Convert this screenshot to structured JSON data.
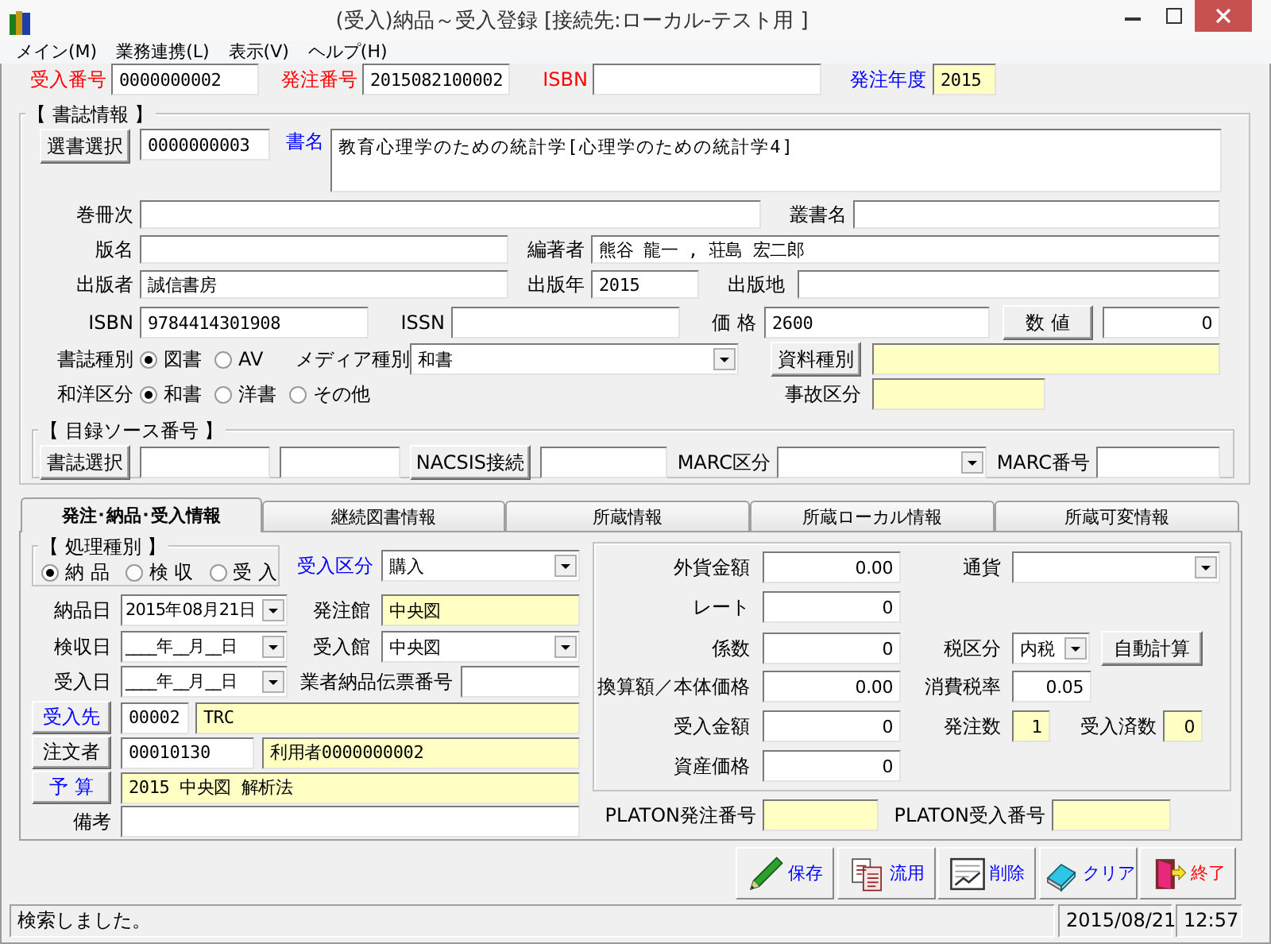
{
  "window": {
    "title": "(受入)納品～受入登録 [接続先:ローカル-テスト用 ]"
  },
  "menu": [
    {
      "label": "メイン(M)"
    },
    {
      "label": "業務連携(L)"
    },
    {
      "label": "表示(V)"
    },
    {
      "label": "ヘルプ(H)"
    }
  ],
  "header": [
    {
      "kind": "label",
      "text": "受入番号",
      "color": "#ff0000"
    },
    {
      "kind": "input",
      "value": "0000000002",
      "readonly": false
    },
    {
      "kind": "label",
      "text": "発注番号",
      "color": "#ff0000"
    },
    {
      "kind": "input",
      "value": "2015082100002",
      "readonly": false
    },
    {
      "kind": "label",
      "text": "ISBN",
      "color": "#ff0000"
    },
    {
      "kind": "input",
      "readonly": false
    },
    {
      "kind": "label",
      "text": "発注年度",
      "color": "#0000ff"
    },
    {
      "kind": "input",
      "value": "2015",
      "readonly": true
    }
  ],
  "bibliography": {
    "title": "【 書誌情報 】",
    "rows": [
      [
        {
          "kind": "button",
          "label": "選書選択"
        },
        {
          "kind": "input",
          "value": "0000000003",
          "readonly": false
        },
        {
          "kind": "label",
          "text": "書名",
          "color": "#0000ff"
        },
        {
          "kind": "textarea",
          "value": "教育心理学のための統計学[心理学のための統計学4]",
          "readonly": false
        }
      ],
      [
        {
          "kind": "label",
          "text": "巻冊次"
        },
        {
          "kind": "input",
          "readonly": false
        },
        {
          "kind": "label",
          "text": "叢書名"
        },
        {
          "kind": "input",
          "readonly": false
        }
      ],
      [
        {
          "kind": "label",
          "text": "版名"
        },
        {
          "kind": "input",
          "readonly": false
        },
        {
          "kind": "label",
          "text": "編著者"
        },
        {
          "kind": "input",
          "value": "熊谷 龍一 , 荘島 宏二郎",
          "readonly": false
        }
      ],
      [
        {
          "kind": "label",
          "text": "出版者"
        },
        {
          "kind": "input",
          "value": "誠信書房",
          "readonly": false
        },
        {
          "kind": "label",
          "text": "出版年"
        },
        {
          "kind": "input",
          "value": "2015",
          "readonly": false
        },
        {
          "kind": "label",
          "text": "出版地"
        },
        {
          "kind": "input",
          "readonly": false
        }
      ],
      [
        {
          "kind": "label",
          "text": "ISBN"
        },
        {
          "kind": "input",
          "value": "9784414301908",
          "readonly": false
        },
        {
          "kind": "label",
          "text": "ISSN"
        },
        {
          "kind": "input",
          "readonly": false
        },
        {
          "kind": "label",
          "text": "価 格"
        },
        {
          "kind": "input",
          "value": "2600",
          "readonly": false
        },
        {
          "kind": "button",
          "label": "数 値"
        },
        {
          "kind": "number",
          "value": "0",
          "readonly": false
        }
      ],
      [
        {
          "kind": "label",
          "text": "書誌種別"
        },
        {
          "kind": "radio",
          "options": [
            {
              "label": "図書",
              "selected": true
            },
            {
              "label": "AV",
              "selected": false
            }
          ]
        },
        {
          "kind": "label",
          "text": "メディア種別"
        },
        {
          "kind": "select",
          "value": "和書"
        },
        {
          "kind": "button",
          "label": "資料種別"
        },
        {
          "kind": "input",
          "readonly": true
        }
      ],
      [
        {
          "kind": "label",
          "text": "和洋区分"
        },
        {
          "kind": "radio",
          "options": [
            {
              "label": "和書",
              "selected": true
            },
            {
              "label": "洋書",
              "selected": false
            },
            {
              "label": "その他",
              "selected": false
            }
          ]
        },
        {
          "kind": "label",
          "text": "事故区分"
        },
        {
          "kind": "input",
          "readonly": true
        }
      ]
    ]
  },
  "source_numbers": {
    "title": "【 目録ソース番号 】",
    "items": [
      {
        "kind": "button",
        "label": "書誌選択"
      },
      {
        "kind": "input",
        "readonly": false
      },
      {
        "kind": "input",
        "readonly": false
      },
      {
        "kind": "button",
        "label": "NACSIS接続"
      },
      {
        "kind": "input",
        "readonly": false
      },
      {
        "kind": "label",
        "text": "MARC区分"
      },
      {
        "kind": "select"
      },
      {
        "kind": "label",
        "text": "MARC番号"
      },
      {
        "kind": "input",
        "readonly": false
      }
    ]
  },
  "tabs": [
    {
      "label": "発注･納品･受入情報",
      "selected": true
    },
    {
      "label": "継続図書情報",
      "selected": false
    },
    {
      "label": "所蔵情報",
      "selected": false
    },
    {
      "label": "所蔵ローカル情報",
      "selected": false
    },
    {
      "label": "所蔵可変情報",
      "selected": false
    }
  ],
  "order_rows": [
    [
      {
        "kind": "group",
        "title": "【 処理種別 】",
        "options": [
          {
            "label": "納 品",
            "selected": true
          },
          {
            "label": "検 収",
            "selected": false
          },
          {
            "label": "受 入",
            "selected": false
          }
        ]
      },
      {
        "kind": "label",
        "text": "受入区分",
        "color": "#0000ff"
      },
      {
        "kind": "select",
        "value": "購入"
      }
    ],
    [
      {
        "kind": "label",
        "text": "納品日"
      },
      {
        "kind": "date",
        "value": "2015年08月21日"
      },
      {
        "kind": "label",
        "text": "発注館"
      },
      {
        "kind": "input",
        "value": "中央図",
        "readonly": true
      }
    ],
    [
      {
        "kind": "label",
        "text": "検収日"
      },
      {
        "kind": "date",
        "value": "____年__月__日"
      },
      {
        "kind": "label",
        "text": "受入館"
      },
      {
        "kind": "select",
        "value": "中央図"
      }
    ],
    [
      {
        "kind": "label",
        "text": "受入日"
      },
      {
        "kind": "date",
        "value": "____年__月__日"
      },
      {
        "kind": "label",
        "text": "業者納品伝票番号"
      },
      {
        "kind": "input",
        "readonly": false
      }
    ],
    [
      {
        "kind": "button",
        "label": "受入先",
        "color": "#0000ff"
      },
      {
        "kind": "input",
        "value": "00002",
        "readonly": false
      },
      {
        "kind": "input",
        "value": "TRC",
        "readonly": true
      }
    ],
    [
      {
        "kind": "button",
        "label": "注文者"
      },
      {
        "kind": "input",
        "value": "00010130",
        "readonly": false
      },
      {
        "kind": "input",
        "value": "利用者0000000002",
        "readonly": true
      }
    ],
    [
      {
        "kind": "button",
        "label": "予 算",
        "color": "#0000ff"
      },
      {
        "kind": "input",
        "value": "2015 中央図 解析法",
        "readonly": true
      }
    ],
    [
      {
        "kind": "label",
        "text": "備考"
      },
      {
        "kind": "input",
        "readonly": false
      }
    ]
  ],
  "amount_rows": [
    [
      {
        "kind": "label",
        "text": "外貨金額"
      },
      {
        "kind": "number",
        "value": "0.00",
        "readonly": false
      },
      {
        "kind": "label",
        "text": "通貨"
      },
      {
        "kind": "select"
      }
    ],
    [
      {
        "kind": "label",
        "text": "レート"
      },
      {
        "kind": "number",
        "value": "0",
        "readonly": false
      }
    ],
    [
      {
        "kind": "label",
        "text": "係数"
      },
      {
        "kind": "number",
        "value": "0",
        "readonly": false
      },
      {
        "kind": "label",
        "text": "税区分"
      },
      {
        "kind": "select",
        "value": "内税"
      },
      {
        "kind": "button",
        "label": "自動計算"
      }
    ],
    [
      {
        "kind": "label",
        "text": "換算額／本体価格"
      },
      {
        "kind": "number",
        "value": "0.00",
        "readonly": false
      },
      {
        "kind": "label",
        "text": "消費税率"
      },
      {
        "kind": "number",
        "value": "0.05",
        "readonly": false
      }
    ],
    [
      {
        "kind": "label",
        "text": "受入金額"
      },
      {
        "kind": "number",
        "value": "0",
        "readonly": false
      },
      {
        "kind": "label",
        "text": "発注数"
      },
      {
        "kind": "number",
        "value": "1",
        "readonly": true
      },
      {
        "kind": "label",
        "text": "受入済数"
      },
      {
        "kind": "number",
        "value": "0",
        "readonly": true
      }
    ],
    [
      {
        "kind": "label",
        "text": "資産価格"
      },
      {
        "kind": "number",
        "value": "0",
        "readonly": false
      }
    ]
  ],
  "platon": [
    {
      "kind": "label",
      "text": "PLATON発注番号"
    },
    {
      "kind": "input",
      "readonly": true
    },
    {
      "kind": "label",
      "text": "PLATON受入番号"
    },
    {
      "kind": "input",
      "readonly": true
    }
  ],
  "toolbar": [
    {
      "kind": "save",
      "label": "保存",
      "color": "#0000ff"
    },
    {
      "kind": "copy",
      "label": "流用",
      "color": "#0000ff"
    },
    {
      "kind": "delete",
      "label": "削除",
      "color": "#0000ff"
    },
    {
      "kind": "clear",
      "label": "クリア",
      "color": "#0000ff"
    },
    {
      "kind": "exit",
      "label": "終了",
      "color": "#ff0000"
    }
  ],
  "status_bar": {
    "message": "検索しました。",
    "date": "2015/08/21",
    "time": "12:57"
  }
}
